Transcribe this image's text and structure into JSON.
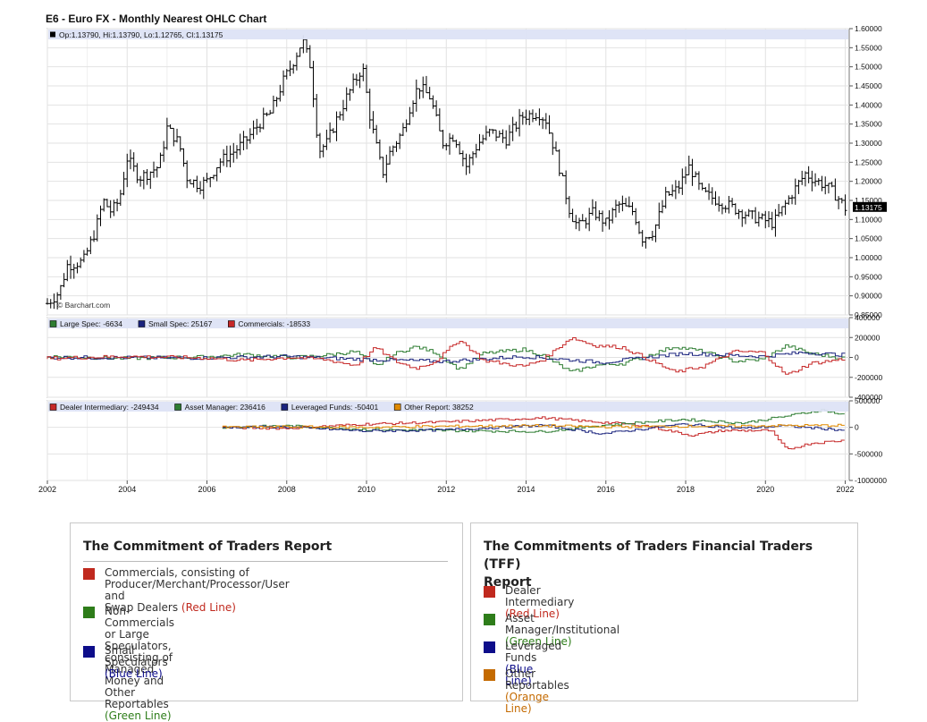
{
  "chart_data": {
    "type": "ohlc",
    "title": "E6 - Euro FX - Monthly Nearest OHLC Chart",
    "watermark": "© Barchart.com",
    "ohlc_readout": "Op:1.13790, Hi:1.13790, Lo:1.12765, Cl:1.13175",
    "last_price_label": "1.13175",
    "last_price": 1.13175,
    "x_range": [
      2002,
      2022.1
    ],
    "x_ticks": [
      "2002",
      "2004",
      "2006",
      "2008",
      "2010",
      "2012",
      "2014",
      "2016",
      "2018",
      "2020",
      "2022"
    ],
    "price_panel": {
      "ylim": [
        0.85,
        1.6
      ],
      "y_ticks": [
        "0.85000",
        "0.90000",
        "0.95000",
        "1.00000",
        "1.05000",
        "1.10000",
        "1.15000",
        "1.20000",
        "1.25000",
        "1.30000",
        "1.35000",
        "1.40000",
        "1.45000",
        "1.50000",
        "1.55000",
        "1.60000"
      ],
      "close_path": [
        [
          2002.0,
          0.88
        ],
        [
          2002.3,
          0.91
        ],
        [
          2002.5,
          0.98
        ],
        [
          2002.9,
          0.99
        ],
        [
          2003.2,
          1.07
        ],
        [
          2003.4,
          1.15
        ],
        [
          2003.6,
          1.12
        ],
        [
          2003.8,
          1.15
        ],
        [
          2004.0,
          1.26
        ],
        [
          2004.3,
          1.21
        ],
        [
          2004.5,
          1.22
        ],
        [
          2004.8,
          1.24
        ],
        [
          2005.0,
          1.34
        ],
        [
          2005.3,
          1.3
        ],
        [
          2005.5,
          1.21
        ],
        [
          2005.8,
          1.19
        ],
        [
          2006.0,
          1.2
        ],
        [
          2006.3,
          1.25
        ],
        [
          2006.7,
          1.28
        ],
        [
          2007.0,
          1.31
        ],
        [
          2007.3,
          1.35
        ],
        [
          2007.6,
          1.38
        ],
        [
          2007.9,
          1.46
        ],
        [
          2008.1,
          1.5
        ],
        [
          2008.4,
          1.57
        ],
        [
          2008.6,
          1.5
        ],
        [
          2008.8,
          1.28
        ],
        [
          2009.0,
          1.3
        ],
        [
          2009.2,
          1.35
        ],
        [
          2009.5,
          1.42
        ],
        [
          2009.9,
          1.5
        ],
        [
          2010.1,
          1.36
        ],
        [
          2010.4,
          1.22
        ],
        [
          2010.6,
          1.28
        ],
        [
          2010.9,
          1.33
        ],
        [
          2011.1,
          1.4
        ],
        [
          2011.3,
          1.45
        ],
        [
          2011.6,
          1.42
        ],
        [
          2011.9,
          1.3
        ],
        [
          2012.2,
          1.32
        ],
        [
          2012.5,
          1.24
        ],
        [
          2012.8,
          1.3
        ],
        [
          2013.1,
          1.33
        ],
        [
          2013.5,
          1.31
        ],
        [
          2013.9,
          1.37
        ],
        [
          2014.3,
          1.38
        ],
        [
          2014.5,
          1.36
        ],
        [
          2014.8,
          1.25
        ],
        [
          2015.1,
          1.12
        ],
        [
          2015.3,
          1.08
        ],
        [
          2015.7,
          1.12
        ],
        [
          2016.0,
          1.09
        ],
        [
          2016.3,
          1.14
        ],
        [
          2016.7,
          1.12
        ],
        [
          2016.9,
          1.05
        ],
        [
          2017.2,
          1.07
        ],
        [
          2017.5,
          1.16
        ],
        [
          2017.8,
          1.18
        ],
        [
          2018.1,
          1.24
        ],
        [
          2018.4,
          1.17
        ],
        [
          2018.8,
          1.15
        ],
        [
          2019.2,
          1.13
        ],
        [
          2019.6,
          1.11
        ],
        [
          2019.9,
          1.1
        ],
        [
          2020.2,
          1.09
        ],
        [
          2020.5,
          1.14
        ],
        [
          2020.8,
          1.19
        ],
        [
          2021.0,
          1.22
        ],
        [
          2021.3,
          1.2
        ],
        [
          2021.5,
          1.19
        ],
        [
          2021.8,
          1.16
        ],
        [
          2022.0,
          1.13
        ]
      ]
    },
    "cot_panel": {
      "ylim": [
        -400000,
        400000
      ],
      "y_ticks": [
        "400000",
        "200000",
        "0",
        "-200000",
        "-400000"
      ],
      "series": [
        {
          "name": "Large Spec",
          "legend": "Large Spec: -6634",
          "color": "#2e7d32",
          "points": [
            [
              2002.0,
              10000
            ],
            [
              2004.0,
              -10000
            ],
            [
              2006.0,
              5000
            ],
            [
              2007.0,
              30000
            ],
            [
              2008.2,
              0
            ],
            [
              2009.0,
              20000
            ],
            [
              2009.8,
              60000
            ],
            [
              2010.3,
              -90000
            ],
            [
              2010.8,
              40000
            ],
            [
              2011.3,
              110000
            ],
            [
              2011.8,
              50000
            ],
            [
              2012.4,
              -120000
            ],
            [
              2013.0,
              40000
            ],
            [
              2014.0,
              80000
            ],
            [
              2014.5,
              20000
            ],
            [
              2015.2,
              -150000
            ],
            [
              2015.8,
              -80000
            ],
            [
              2016.5,
              -60000
            ],
            [
              2017.2,
              30000
            ],
            [
              2017.8,
              110000
            ],
            [
              2018.5,
              60000
            ],
            [
              2019.3,
              -40000
            ],
            [
              2020.0,
              -20000
            ],
            [
              2020.6,
              120000
            ],
            [
              2021.2,
              40000
            ],
            [
              2022.0,
              -6634
            ]
          ]
        },
        {
          "name": "Small Spec",
          "legend": "Small Spec: 25167",
          "color": "#1a237e",
          "points": [
            [
              2002.0,
              0
            ],
            [
              2006.0,
              -5000
            ],
            [
              2008.0,
              10000
            ],
            [
              2010.0,
              -20000
            ],
            [
              2012.0,
              -40000
            ],
            [
              2014.0,
              10000
            ],
            [
              2016.0,
              -50000
            ],
            [
              2018.0,
              40000
            ],
            [
              2020.0,
              10000
            ],
            [
              2021.0,
              50000
            ],
            [
              2022.0,
              25167
            ]
          ]
        },
        {
          "name": "Commercials",
          "legend": "Commercials: -18533",
          "color": "#c62828",
          "points": [
            [
              2002.0,
              -10000
            ],
            [
              2004.0,
              10000
            ],
            [
              2006.0,
              -5000
            ],
            [
              2007.0,
              -30000
            ],
            [
              2008.2,
              0
            ],
            [
              2009.0,
              -20000
            ],
            [
              2009.8,
              -80000
            ],
            [
              2010.3,
              100000
            ],
            [
              2010.8,
              -40000
            ],
            [
              2011.3,
              -110000
            ],
            [
              2011.8,
              -40000
            ],
            [
              2012.4,
              180000
            ],
            [
              2013.0,
              -30000
            ],
            [
              2014.0,
              -90000
            ],
            [
              2014.5,
              -20000
            ],
            [
              2015.2,
              200000
            ],
            [
              2015.8,
              120000
            ],
            [
              2016.5,
              100000
            ],
            [
              2017.2,
              -30000
            ],
            [
              2017.8,
              -150000
            ],
            [
              2018.5,
              -90000
            ],
            [
              2019.3,
              60000
            ],
            [
              2020.0,
              50000
            ],
            [
              2020.6,
              -180000
            ],
            [
              2021.2,
              -60000
            ],
            [
              2022.0,
              -18533
            ]
          ]
        }
      ]
    },
    "tff_panel": {
      "ylim": [
        -1000000,
        500000
      ],
      "y_ticks": [
        "500000",
        "0",
        "-500000",
        "-1000000"
      ],
      "series": [
        {
          "name": "Dealer Intermediary",
          "legend": "Dealer Intermediary: -249434",
          "color": "#c62828",
          "points": [
            [
              2006.4,
              0
            ],
            [
              2008.0,
              -20000
            ],
            [
              2010.0,
              60000
            ],
            [
              2012.0,
              100000
            ],
            [
              2014.5,
              180000
            ],
            [
              2015.5,
              120000
            ],
            [
              2017.0,
              40000
            ],
            [
              2018.2,
              -150000
            ],
            [
              2019.0,
              -60000
            ],
            [
              2020.2,
              -60000
            ],
            [
              2020.6,
              -420000
            ],
            [
              2021.2,
              -300000
            ],
            [
              2022.0,
              -249434
            ]
          ]
        },
        {
          "name": "Asset Manager",
          "legend": "Asset Manager: 236416",
          "color": "#2e7d32",
          "points": [
            [
              2006.4,
              0
            ],
            [
              2008.0,
              30000
            ],
            [
              2010.0,
              -40000
            ],
            [
              2012.0,
              -60000
            ],
            [
              2014.5,
              -80000
            ],
            [
              2016.0,
              40000
            ],
            [
              2018.0,
              150000
            ],
            [
              2019.5,
              80000
            ],
            [
              2020.5,
              200000
            ],
            [
              2021.5,
              330000
            ],
            [
              2022.0,
              236416
            ]
          ]
        },
        {
          "name": "Leveraged Funds",
          "legend": "Leveraged Funds: -50401",
          "color": "#1a237e",
          "points": [
            [
              2006.4,
              0
            ],
            [
              2008.0,
              10000
            ],
            [
              2010.0,
              -70000
            ],
            [
              2012.0,
              -50000
            ],
            [
              2014.5,
              40000
            ],
            [
              2016.0,
              -120000
            ],
            [
              2018.0,
              60000
            ],
            [
              2019.5,
              -20000
            ],
            [
              2020.5,
              30000
            ],
            [
              2022.0,
              -50401
            ]
          ]
        },
        {
          "name": "Other Report",
          "legend": "Other Report: 38252",
          "color": "#e08a00",
          "points": [
            [
              2006.4,
              0
            ],
            [
              2008.0,
              10000
            ],
            [
              2010.0,
              0
            ],
            [
              2012.0,
              20000
            ],
            [
              2014.5,
              30000
            ],
            [
              2016.0,
              10000
            ],
            [
              2018.0,
              20000
            ],
            [
              2020.0,
              30000
            ],
            [
              2022.0,
              38252
            ]
          ]
        }
      ]
    }
  },
  "legend_left": {
    "title": "The Commitment of Traders Report",
    "items": [
      {
        "color": "#c0291e",
        "lines": [
          "Commercials, consisting of Producer/Merchant/Processor/User and",
          "Swap Dealers "
        ],
        "paren": "(Red Line)",
        "paren_color": "#c0291e"
      },
      {
        "color": "#2e7d1a",
        "lines": [
          "Non-Commercials or Large Speculators, consisting of Managed",
          "Money and Other Reportables "
        ],
        "paren": "(Green Line)",
        "paren_color": "#2e7d1a"
      },
      {
        "color": "#0d0d8a",
        "lines": [
          "Small Speculators "
        ],
        "paren": "(Blue Line)",
        "paren_color": "#0d0d8a"
      }
    ]
  },
  "legend_right": {
    "title_lines": [
      "The Commitments of Traders Financial Traders (TFF)",
      "Report"
    ],
    "items": [
      {
        "color": "#c0291e",
        "label": "Dealer Intermediary ",
        "paren": "(Red Line)",
        "paren_color": "#c0291e"
      },
      {
        "color": "#2e7d1a",
        "label": "Asset Manager/Institutional ",
        "paren": "(Green Line)",
        "paren_color": "#2e7d1a"
      },
      {
        "color": "#0d0d8a",
        "label": "Leveraged Funds ",
        "paren": "(Blue Line)",
        "paren_color": "#0d0d8a"
      },
      {
        "color": "#c46a00",
        "label": "Other Reportables ",
        "paren": "(Orange Line)",
        "paren_color": "#c46a00"
      }
    ]
  }
}
